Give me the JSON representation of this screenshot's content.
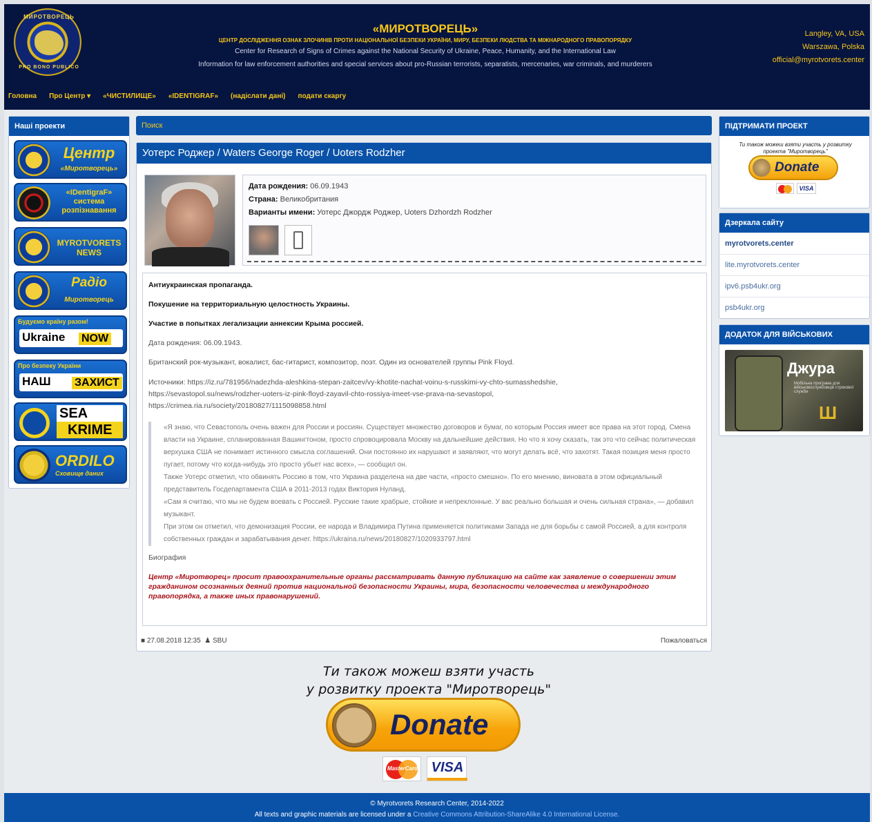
{
  "header": {
    "seal_top": "МИРОТВОРЕЦЬ",
    "seal_bottom": "PRO BONO PUBLICO",
    "title": "«МИРОТВОРЕЦЬ»",
    "subtitle_ua": "ЦЕНТР ДОСЛІДЖЕННЯ ОЗНАК ЗЛОЧИНІВ ПРОТИ НАЦІОНАЛЬНОЇ БЕЗПЕКИ УКРАЇНИ, МИРУ, БЕЗПЕКИ ЛЮДСТВА ТА МІЖНАРОДНОГО ПРАВОПОРЯДКУ",
    "subtitle_en": "Center for Research of Signs of Crimes against the National Security of Ukraine, Peace, Humanity, and the International Law",
    "info": "Information for law enforcement authorities and special services about pro-Russian terrorists, separatists, mercenaries, war criminals, and murderers",
    "contacts": [
      "Langley, VA, USA",
      "Warszawa, Polska",
      "official@myrotvorets.center"
    ]
  },
  "nav": {
    "home": "Головна",
    "about": "Про Центр",
    "purgatory": "«ЧИСТИЛИЩЕ»",
    "identigraf": "«IDENTIGRAF»",
    "send_data": "(надіслати дані)",
    "complaint": "подати скаргу"
  },
  "sidebar": {
    "title": "Наші проекти",
    "center_t1": "Центр",
    "center_t2": "«Миротворець»",
    "identi_1": "«IDentigraF»",
    "identi_2": "система",
    "identi_3": "розпізнавання",
    "news_1": "MYROTVORETS",
    "news_2": "NEWS",
    "radio_1": "Радіо",
    "radio_2": "Миротворець",
    "ukr_top": "Будуємо країну разом!",
    "ukr_a": "Ukraine",
    "ukr_b": "NOW",
    "nash_top": "Про безпеку України",
    "nash_a": "НАШ",
    "nash_b": "ЗАХИСТ",
    "sea_a": "SEA",
    "sea_b": "KRIME",
    "ordilo_a": "ORDILO",
    "ordilo_b": "Сховище даних"
  },
  "search_label": "Поиск",
  "profile": {
    "name": "Уотерс Роджер / Waters George Roger / Uoters Rodzher",
    "dob_label": "Дата рождения:",
    "dob": "06.09.1943",
    "country_label": "Страна:",
    "country": "Великобритания",
    "variants_label": "Варианты имени:",
    "variants": "Уотерс Джордж Роджер, Uoters Dzhordzh Rodzher",
    "p1": "Антиукраинская пропаганда.",
    "p2": "Покушение на территориальную целостность Украины.",
    "p3": "Участие в попытках легализации аннексии Крыма россией.",
    "p4": "Дата рождения: 06.09.1943.",
    "p5": "Британский рок-музыкант, вокалист, бас-гитарист, композитор, поэт. Один из основателей группы Pink Floyd.",
    "src_label": "Источники:",
    "src1": "https://iz.ru/781956/nadezhda-aleshkina-stepan-zaitcev/vy-khotite-nachat-voinu-s-russkimi-vy-chto-sumasshedshie,",
    "src2": "https://sevastopol.su/news/rodzher-uoters-iz-pink-floyd-zayavil-chto-rossiya-imeet-vse-prava-na-sevastopol,",
    "src3": "https://crimea.ria.ru/society/20180827/1115098858.html",
    "quote1": "«Я знаю, что Севастополь очень важен для России и россиян. Существует множество договоров и бумаг, по которым Россия имеет все права на этот город. Смена власти на Украине, спланированная Вашингтоном, просто спровоцировала Москву на дальнейшие действия. Но что я хочу сказать, так это что сейчас политическая верхушка США не понимает истинного смысла соглашений. Они постоянно их нарушают и заявляют, что могут делать всё, что захотят. Такая позиция меня просто пугает, потому что когда-нибудь это просто убьет нас всех», — сообщил он.",
    "quote2": "Также Уотерс отметил, что обвинять Россию в том, что Украина разделена на две части, «просто смешно». По его мнению, виновата в этом официальный представитель Госдепартамента США в 2011-2013 годах Виктория Нуланд.",
    "quote3": "«Сам я считаю, что мы не будем воевать с Россией. Русские такие храбрые, стойкие и непреклонные. У вас реально большая и очень сильная страна», — добавил музыкант.",
    "quote4": "При этом он отметил, что демонизация России, ее народа и Владимира Путина применяется политиками Запада не для борьбы с самой Россией, а для контроля собственных граждан и зарабатывания денег.",
    "quote_link": "https://ukraina.ru/news/20180827/1020933797.html",
    "bio": "Биография",
    "warning": "Центр «Миротворец» просит правоохранительные органы рассматривать данную публикацию на сайте как заявление о совершении этим гражданином осознанных деяний против национальной безопасности Украины, мира, безопасности человечества и международного правопорядка, а также иных правонарушений.",
    "date": "27.08.2018 12:35",
    "author": "SBU",
    "complain": "Пожаловаться"
  },
  "right": {
    "support_title": "ПІДТРИМАТИ ПРОЕКТ",
    "support_invite": "Ти також можеш взяти участь у розвитку проекта \"Миротворець\"",
    "donate": "Donate",
    "visa": "VISA",
    "mirrors_title": "Дзеркала сайту",
    "mirrors": [
      "myrotvorets.center",
      "lite.myrotvorets.center",
      "ipv6.psb4ukr.org",
      "psb4ukr.org"
    ],
    "app_title": "ДОДАТОК ДЛЯ ВІЙСЬКОВИХ",
    "app_name": "Джура",
    "app_sub": "Мобільна програма для військовослужбовців строкової служби"
  },
  "bottom": {
    "invite_1": "Ти також можеш взяти участь",
    "invite_2": "у розвитку проекта \"Миротворець\"",
    "donate": "Donate",
    "mastercard": "MasterCard",
    "visa": "VISA"
  },
  "footer": {
    "copyright": "© Myrotvorets Research Center, 2014-2022",
    "license_prefix": "All texts and graphic materials are licensed under a",
    "license_link": "Creative Commons Attribution-ShareAlike 4.0 International License."
  }
}
